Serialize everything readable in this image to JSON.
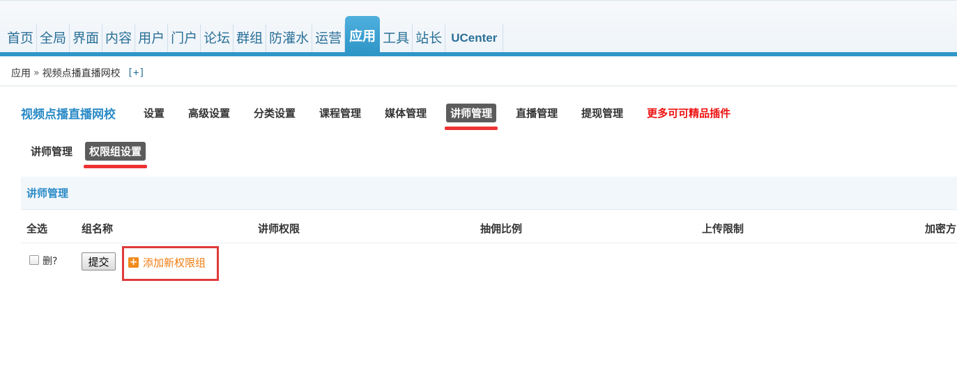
{
  "nav": {
    "items": [
      "首页",
      "全局",
      "界面",
      "内容",
      "用户",
      "门户",
      "论坛",
      "群组",
      "防灌水",
      "运营",
      "应用",
      "工具",
      "站长",
      "UCenter"
    ],
    "active_index": 10
  },
  "breadcrumb": {
    "root": "应用",
    "separator": "»",
    "current": "视频点播直播网校",
    "add": "[+]"
  },
  "plugin": {
    "title": "视频点播直播网校",
    "tabs": [
      "设置",
      "高级设置",
      "分类设置",
      "课程管理",
      "媒体管理",
      "讲师管理",
      "直播管理",
      "提现管理"
    ],
    "active_tab": "讲师管理",
    "more_link": "更多可可精品插件"
  },
  "subtabs": {
    "items": [
      "讲师管理",
      "权限组设置"
    ],
    "active": "权限组设置"
  },
  "section": {
    "title": "讲师管理"
  },
  "table": {
    "headers": [
      "全选",
      "组名称",
      "讲师权限",
      "抽佣比例",
      "上传限制",
      "加密方"
    ]
  },
  "actions": {
    "delete_label": "删?",
    "submit_label": "提交",
    "add_group_label": "添加新权限组",
    "add_icon": "plus-square-icon"
  },
  "colors": {
    "accent": "#2f96c8",
    "highlight_red": "#ee3333",
    "add_orange": "#f07d12"
  }
}
